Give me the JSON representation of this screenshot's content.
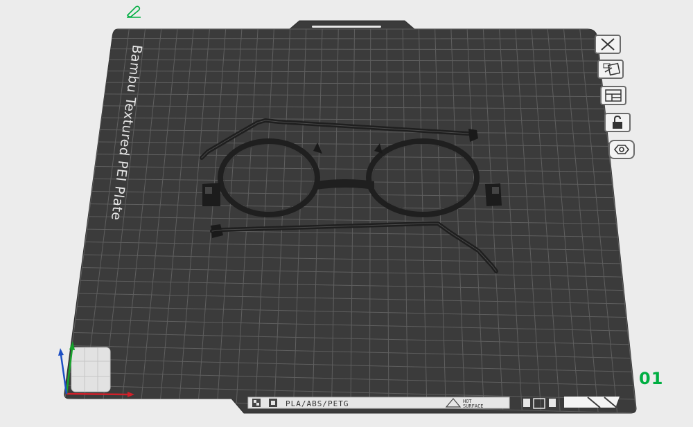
{
  "plate": {
    "name": "Bambu Textured PEI Plate",
    "number": "01",
    "material_label": "PLA/ABS/PETG",
    "warning_label_line1": "HOT",
    "warning_label_line2": "SURFACE"
  },
  "toolbar": {
    "icons": [
      "close-icon",
      "auto-arrange-icon",
      "plate-layout-icon",
      "lock-icon",
      "settings-icon"
    ]
  },
  "model": {
    "name": "glasses-frame",
    "parts": [
      "front-frame",
      "left-temple-arm",
      "right-temple-arm"
    ]
  },
  "colors": {
    "background": "#ececec",
    "plate": "#3b3b3b",
    "grid": "#5f5f5f",
    "model": "#232323",
    "accent": "#00ae42",
    "axis_x": "#d0202a",
    "axis_y": "#16a32b",
    "axis_z": "#1d4fc4"
  }
}
